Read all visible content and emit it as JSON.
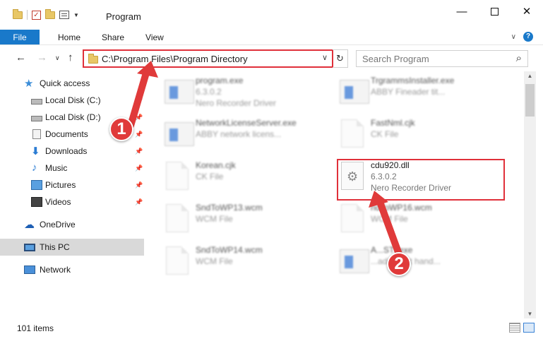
{
  "window": {
    "title": "Program",
    "controls": {
      "minimize": "—",
      "maximize": "",
      "close": "✕"
    }
  },
  "ribbon": {
    "tabs": [
      "File",
      "Home",
      "Share",
      "View"
    ],
    "help": "?"
  },
  "nav": {
    "address": "C:\\Program Files\\Program Directory",
    "search_placeholder": "Search Program"
  },
  "sidebar": {
    "items": [
      {
        "label": "Quick access",
        "icon": "star-icon"
      },
      {
        "label": "Local Disk (C:)",
        "icon": "disk-icon",
        "pinned": true
      },
      {
        "label": "Local Disk (D:)",
        "icon": "disk-icon",
        "pinned": true
      },
      {
        "label": "Documents",
        "icon": "documents-icon",
        "pinned": true
      },
      {
        "label": "Downloads",
        "icon": "download-icon",
        "pinned": true
      },
      {
        "label": "Music",
        "icon": "music-icon",
        "pinned": true
      },
      {
        "label": "Pictures",
        "icon": "pictures-icon",
        "pinned": true
      },
      {
        "label": "Videos",
        "icon": "videos-icon",
        "pinned": true
      },
      {
        "label": "OneDrive",
        "icon": "onedrive-icon"
      },
      {
        "label": "This PC",
        "icon": "pc-icon",
        "selected": true
      },
      {
        "label": "Network",
        "icon": "network-icon"
      }
    ]
  },
  "files": [
    {
      "name": "program.exe",
      "line1": "6.3.0.2",
      "line2": "Nero Recorder Driver",
      "type": "exe"
    },
    {
      "name": "TrgrammsInstaller.exe",
      "line1": "ABBY Fineader tit...",
      "line2": "",
      "type": "exe"
    },
    {
      "name": "NetworkLicenseServer.exe",
      "line1": "ABBY network licens...",
      "line2": "",
      "type": "exe"
    },
    {
      "name": "FastNml.cjk",
      "line1": "CK File",
      "line2": "",
      "type": "cjk"
    },
    {
      "name": "Korean.cjk",
      "line1": "CK File",
      "line2": "",
      "type": "cjk"
    },
    {
      "name": "cdu920.dll",
      "line1": "6.3.0.2",
      "line2": "Nero Recorder Driver",
      "type": "dll"
    },
    {
      "name": "SndToWP13.wcm",
      "line1": "WCM File",
      "line2": "",
      "type": "cjk"
    },
    {
      "name": "ndToWP16.wcm",
      "line1": "WCM File",
      "line2": "",
      "type": "cjk"
    },
    {
      "name": "SndToWP14.wcm",
      "line1": "WCM File",
      "line2": "",
      "type": "cjk"
    },
    {
      "name": "A...STI.exe",
      "line1": "...adi event hand...",
      "line2": "",
      "type": "exe"
    }
  ],
  "status": {
    "count": "101 items"
  },
  "callouts": [
    "1",
    "2"
  ],
  "colors": {
    "accent": "#1979ca",
    "highlight": "#e0303a"
  }
}
